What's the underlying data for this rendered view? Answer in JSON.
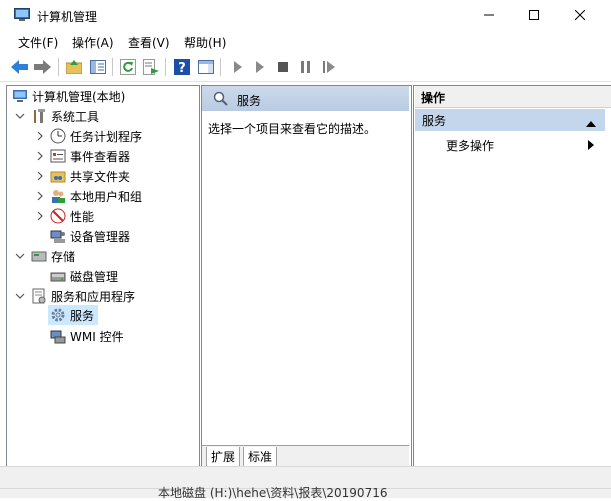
{
  "window": {
    "title": "计算机管理",
    "minimize_glyph": "—",
    "maximize_glyph": "☐",
    "close_glyph": "✕"
  },
  "menu": [
    "文件(F)",
    "操作(A)",
    "查看(V)",
    "帮助(H)"
  ],
  "toolbar": {
    "icons": [
      "back-arrow-icon",
      "forward-arrow-icon",
      "up-folder-icon",
      "show-hide-tree-icon",
      "refresh-icon",
      "export-list-icon",
      "help-icon",
      "show-hide-action-pane-icon",
      "play-icon",
      "play-outline-icon",
      "stop-icon",
      "pause-icon",
      "restart-icon"
    ]
  },
  "tree": {
    "root": "计算机管理(本地)",
    "system_tools": "系统工具",
    "task_scheduler": "任务计划程序",
    "event_viewer": "事件查看器",
    "shared_folders": "共享文件夹",
    "local_users": "本地用户和组",
    "performance": "性能",
    "device_manager": "设备管理器",
    "storage": "存储",
    "disk_management": "磁盘管理",
    "services_apps": "服务和应用程序",
    "services": "服务",
    "wmi": "WMI 控件"
  },
  "center": {
    "header": "服务",
    "description": "选择一个项目来查看它的描述。",
    "tabs": [
      "扩展",
      "标准"
    ]
  },
  "actions": {
    "header": "操作",
    "section": "服务",
    "more": "更多操作"
  },
  "status": {
    "text": "本地磁盘 (H:)\\hehe\\资料\\报表\\20190716"
  },
  "colors": {
    "selection": "#cce8ff",
    "section_bg": "#c4d6ec",
    "accent": "#0078d7"
  }
}
